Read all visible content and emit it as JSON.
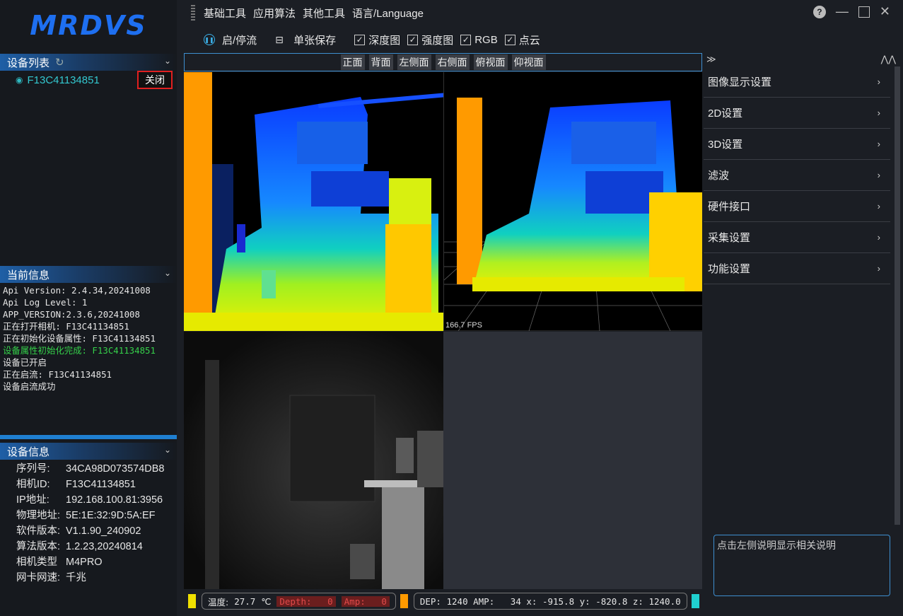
{
  "logo": "MRDVS",
  "menus": [
    "基础工具",
    "应用算法",
    "其他工具",
    "语言/Language"
  ],
  "toolbar": {
    "start_stop": "启/停流",
    "save_single": "单张保存",
    "checks": [
      {
        "label": "深度图",
        "checked": true
      },
      {
        "label": "强度图",
        "checked": true
      },
      {
        "label": "RGB",
        "checked": true
      },
      {
        "label": "点云",
        "checked": true
      }
    ]
  },
  "view_buttons": [
    "正面",
    "背面",
    "左侧面",
    "右侧面",
    "俯视面",
    "仰视面"
  ],
  "device_list": {
    "title": "设备列表",
    "device_sn": "F13C41134851",
    "close_label": "关闭"
  },
  "current_info": {
    "title": "当前信息",
    "lines": [
      {
        "text": "Api Version: 2.4.34,20241008",
        "color": "#e6e6e6"
      },
      {
        "text": "Api Log Level: 1",
        "color": "#e6e6e6"
      },
      {
        "text": "APP_VERSION:2.3.6,20241008",
        "color": "#e6e6e6"
      },
      {
        "text": "正在打开相机: F13C41134851",
        "color": "#e6e6e6"
      },
      {
        "text": "正在初始化设备属性: F13C41134851",
        "color": "#e6e6e6"
      },
      {
        "text": "设备属性初始化完成: F13C41134851",
        "color": "#35d04a"
      },
      {
        "text": "设备已开启",
        "color": "#e6e6e6"
      },
      {
        "text": "正在启流: F13C41134851",
        "color": "#e6e6e6"
      },
      {
        "text": "设备启流成功",
        "color": "#e6e6e6"
      }
    ]
  },
  "device_info": {
    "title": "设备信息",
    "rows": [
      {
        "key": "序列号:",
        "value": "34CA98D073574DB8"
      },
      {
        "key": "相机ID:",
        "value": "F13C41134851"
      },
      {
        "key": "IP地址:",
        "value": "192.168.100.81:3956"
      },
      {
        "key": "物理地址:",
        "value": "5E:1E:32:9D:5A:EF"
      },
      {
        "key": "软件版本:",
        "value": "V1.1.90_240902"
      },
      {
        "key": "算法版本:",
        "value": "1.2.23,20240814"
      },
      {
        "key": "相机类型",
        "value": "M4PRO"
      },
      {
        "key": "网卡网速:",
        "value": "千兆"
      }
    ]
  },
  "fps": "166.7 FPS",
  "status": {
    "temp_label": "温度:",
    "temp_value": "27.7",
    "temp_unit": "℃",
    "depth_label": "Depth:",
    "depth_value": "0",
    "amp_label": "Amp:",
    "amp_value": "0",
    "readout": "DEP: 1240 AMP:   34 x: -915.8 y: -820.8 z: 1240.0"
  },
  "settings": [
    "图像显示设置",
    "2D设置",
    "3D设置",
    "滤波",
    "硬件接口",
    "采集设置",
    "功能设置"
  ],
  "help_text": "点击左侧说明显示相关说明",
  "colors": {
    "accent": "#1f7fd0",
    "close_border": "#e02020",
    "log_success": "#35d04a"
  }
}
